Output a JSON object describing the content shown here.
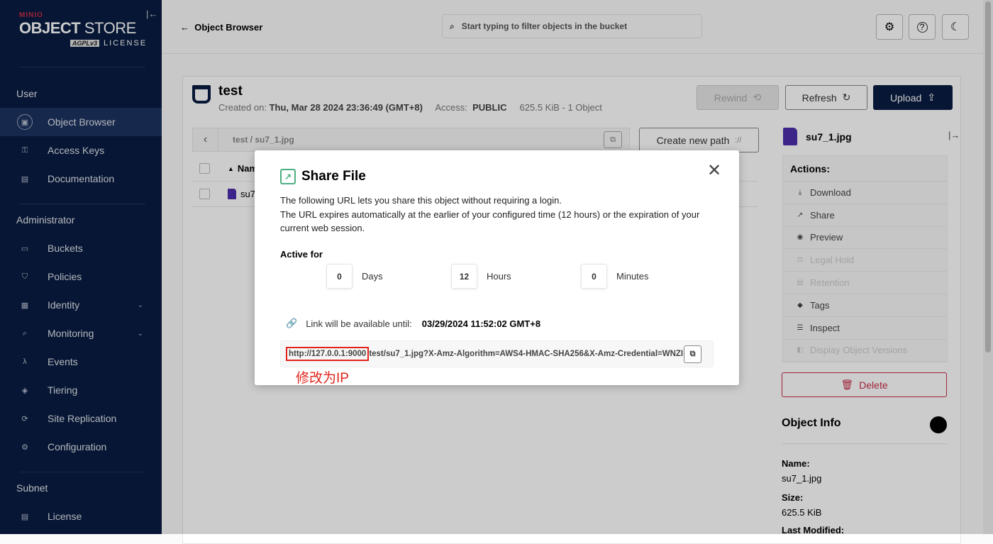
{
  "sidebar": {
    "brand": "MINIO",
    "product_bold": "OBJECT",
    "product_light": "STORE",
    "license_badge": "AGPLv3",
    "license": "LICENSE",
    "sections": [
      {
        "title": "User",
        "items": [
          {
            "label": "Object Browser",
            "icon": "object-browser-icon",
            "active": true
          },
          {
            "label": "Access Keys",
            "icon": "key-icon"
          },
          {
            "label": "Documentation",
            "icon": "document-icon"
          }
        ]
      },
      {
        "title": "Administrator",
        "items": [
          {
            "label": "Buckets",
            "icon": "bucket-icon"
          },
          {
            "label": "Policies",
            "icon": "shield-icon"
          },
          {
            "label": "Identity",
            "icon": "identity-icon",
            "expandable": true
          },
          {
            "label": "Monitoring",
            "icon": "monitoring-icon",
            "expandable": true
          },
          {
            "label": "Events",
            "icon": "lambda-icon"
          },
          {
            "label": "Tiering",
            "icon": "layers-icon"
          },
          {
            "label": "Site Replication",
            "icon": "replication-icon"
          },
          {
            "label": "Configuration",
            "icon": "gear-icon"
          }
        ]
      },
      {
        "title": "Subnet",
        "items": [
          {
            "label": "License",
            "icon": "license-icon"
          }
        ]
      }
    ]
  },
  "topbar": {
    "back_label": "Object Browser",
    "search_placeholder": "Start typing to filter objects in the bucket"
  },
  "bucket": {
    "name": "test",
    "created_label": "Created on:",
    "created": "Thu, Mar 28 2024 23:36:49 (GMT+8)",
    "access_label": "Access:",
    "access": "PUBLIC",
    "size": "625.5 KiB - 1 Object",
    "rewind": "Rewind",
    "refresh": "Refresh",
    "upload": "Upload"
  },
  "browser": {
    "path": "test / su7_1.jpg",
    "create_path": "Create new path",
    "column_name": "Name",
    "files": [
      "su7_1.jpg"
    ]
  },
  "details": {
    "file": "su7_1.jpg",
    "actions_title": "Actions:",
    "actions": [
      {
        "label": "Download",
        "enabled": true,
        "icon": "download-icon"
      },
      {
        "label": "Share",
        "enabled": true,
        "icon": "share-icon"
      },
      {
        "label": "Preview",
        "enabled": true,
        "icon": "eye-icon"
      },
      {
        "label": "Legal Hold",
        "enabled": false,
        "icon": "legal-icon"
      },
      {
        "label": "Retention",
        "enabled": false,
        "icon": "retention-icon"
      },
      {
        "label": "Tags",
        "enabled": true,
        "icon": "tag-icon"
      },
      {
        "label": "Inspect",
        "enabled": true,
        "icon": "inspect-icon"
      },
      {
        "label": "Display Object Versions",
        "enabled": false,
        "icon": "versions-icon"
      }
    ],
    "delete": "Delete",
    "object_info": "Object Info",
    "name_label": "Name:",
    "name": "su7_1.jpg",
    "size_label": "Size:",
    "size": "625.5 KiB",
    "modified_label": "Last Modified:"
  },
  "modal": {
    "title": "Share File",
    "desc1": "The following URL lets you share this object without requiring a login.",
    "desc2": "The URL expires automatically at the earlier of your configured time (12 hours) or the expiration of your current web session.",
    "active_for": "Active for",
    "days": "0",
    "days_label": "Days",
    "hours": "12",
    "hours_label": "Hours",
    "minutes": "0",
    "minutes_label": "Minutes",
    "until_label": "Link will be available until:",
    "until": "03/29/2024 11:52:02 GMT+8",
    "url_host": "http://127.0.0.1:9000",
    "url_rest": "test/su7_1.jpg?X-Amz-Algorithm=AWS4-HMAC-SHA256&X-Amz-Credential=WNZI",
    "annotation": "修改为IP"
  },
  "colors": {
    "sidebar": "#081c42",
    "accent": "#081c42",
    "danger": "#c72c48",
    "annotation": "#e0241c",
    "share": "#4caf82"
  }
}
